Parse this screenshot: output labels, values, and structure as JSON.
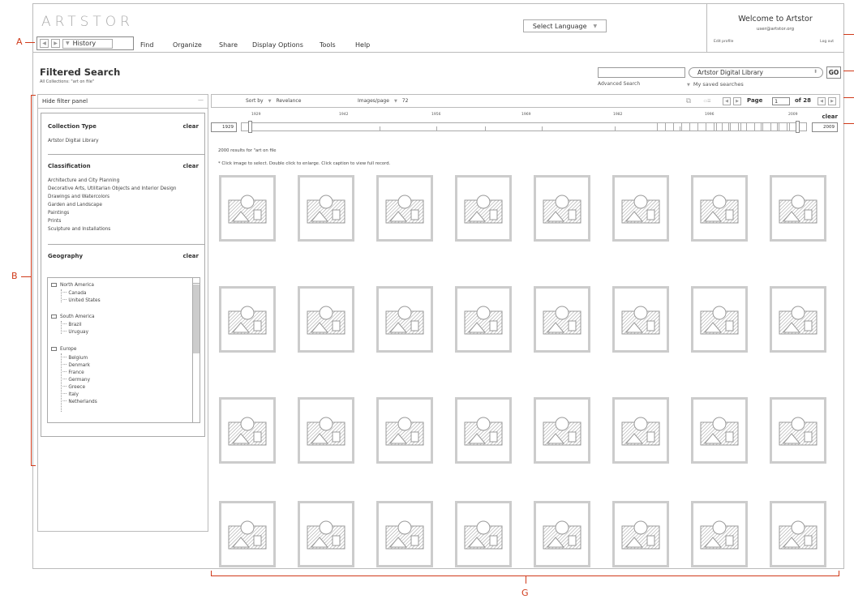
{
  "header": {
    "logo": "ARTSTOR",
    "history_label": "History",
    "menu": [
      "Find",
      "Organize",
      "Share",
      "Display Options",
      "Tools",
      "Help"
    ],
    "language_label": "Select Language",
    "welcome": "Welcome to Artstor",
    "user_email": "user@artstor.org",
    "edit_profile": "Edit profile",
    "logout": "Log out"
  },
  "page": {
    "title": "Filtered Search",
    "subtitle": "All Collections: \"art on file\"",
    "advanced_search": "Advanced Search",
    "library_select": "Artstor Digital Library",
    "go_label": "GO",
    "saved_searches": "My saved searches"
  },
  "filter_panel": {
    "hide_label": "Hide filter panel",
    "collapse_glyph": "—",
    "collection_type": {
      "title": "Collection Type",
      "clear": "clear",
      "items": [
        "Artstor Digital Library"
      ]
    },
    "classification": {
      "title": "Classification",
      "clear": "clear",
      "items": [
        "Architecture and City Planning",
        "Decorative Arts, Utilitarian Objects and Interior Design",
        "Drawings and Watercolors",
        "Garden and Landscape",
        "Paintings",
        "Prints",
        "Sculpture and Installations"
      ]
    },
    "geography": {
      "title": "Geography",
      "clear": "clear",
      "regions": [
        {
          "name": "North America",
          "countries": [
            "Canada",
            "United States"
          ]
        },
        {
          "name": "South America",
          "countries": [
            "Brazil",
            "Uruguay"
          ]
        },
        {
          "name": "Europe",
          "countries": [
            "Belgium",
            "Denmark",
            "France",
            "Germany",
            "Greece",
            "Italy",
            "Netherlands"
          ]
        }
      ]
    }
  },
  "toolbar": {
    "sort_by": "Sort by",
    "sort_value": "Revelance",
    "images_per_page": "Images/page",
    "images_value": "72",
    "page_label": "Page",
    "page_value": "1",
    "of_label": "of 28"
  },
  "timeline": {
    "years": [
      "1929",
      "1942",
      "1956",
      "1969",
      "1982",
      "1996",
      "2009"
    ],
    "start": "1929",
    "end": "2009",
    "clear": "clear"
  },
  "results": {
    "count_text": "2000 results  for \"art on file",
    "hint": "* Click image to select. Double click to enlarge. Click caption to view full record."
  },
  "annotations": {
    "a": "A",
    "b": "B",
    "g": "G"
  },
  "thumbnails": {
    "rows": 4,
    "cols": 8,
    "icon": "image-placeholder-icon"
  }
}
